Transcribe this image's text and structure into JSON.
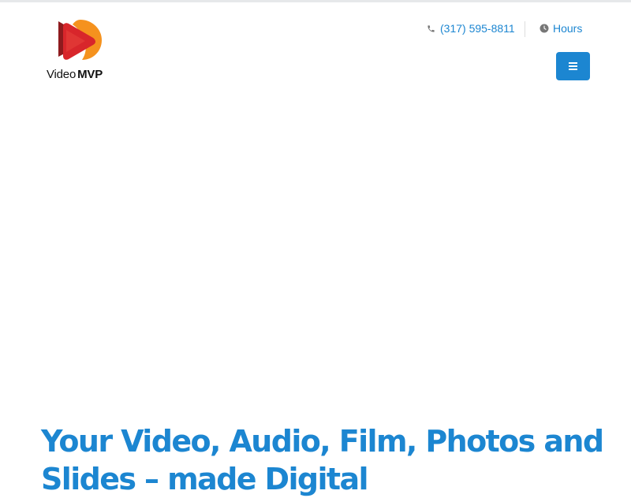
{
  "brand": {
    "wordmark_part1": "Video",
    "wordmark_part2": "MVP"
  },
  "header": {
    "phone_label": "(317) 595-8811",
    "phone_icon": "phone-icon",
    "hours_label": "Hours",
    "hours_icon": "clock-icon",
    "menu_icon": "hamburger-icon"
  },
  "hero": {
    "title_line1": "Your Video, Audio, Film, Photos and",
    "title_line2": "Slides – made Digital"
  },
  "colors": {
    "accent": "#1c86d1",
    "logo_red": "#d8262b",
    "logo_orange": "#f5921e",
    "logo_dark_red": "#8e1b1e"
  }
}
